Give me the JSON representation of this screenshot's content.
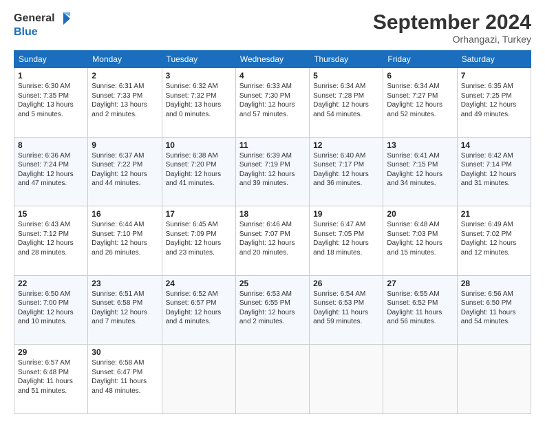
{
  "logo": {
    "line1": "General",
    "line2": "Blue"
  },
  "title": "September 2024",
  "subtitle": "Orhangazi, Turkey",
  "days_of_week": [
    "Sunday",
    "Monday",
    "Tuesday",
    "Wednesday",
    "Thursday",
    "Friday",
    "Saturday"
  ],
  "weeks": [
    [
      {
        "day": "1",
        "info": "Sunrise: 6:30 AM\nSunset: 7:35 PM\nDaylight: 13 hours\nand 5 minutes."
      },
      {
        "day": "2",
        "info": "Sunrise: 6:31 AM\nSunset: 7:33 PM\nDaylight: 13 hours\nand 2 minutes."
      },
      {
        "day": "3",
        "info": "Sunrise: 6:32 AM\nSunset: 7:32 PM\nDaylight: 13 hours\nand 0 minutes."
      },
      {
        "day": "4",
        "info": "Sunrise: 6:33 AM\nSunset: 7:30 PM\nDaylight: 12 hours\nand 57 minutes."
      },
      {
        "day": "5",
        "info": "Sunrise: 6:34 AM\nSunset: 7:28 PM\nDaylight: 12 hours\nand 54 minutes."
      },
      {
        "day": "6",
        "info": "Sunrise: 6:34 AM\nSunset: 7:27 PM\nDaylight: 12 hours\nand 52 minutes."
      },
      {
        "day": "7",
        "info": "Sunrise: 6:35 AM\nSunset: 7:25 PM\nDaylight: 12 hours\nand 49 minutes."
      }
    ],
    [
      {
        "day": "8",
        "info": "Sunrise: 6:36 AM\nSunset: 7:24 PM\nDaylight: 12 hours\nand 47 minutes."
      },
      {
        "day": "9",
        "info": "Sunrise: 6:37 AM\nSunset: 7:22 PM\nDaylight: 12 hours\nand 44 minutes."
      },
      {
        "day": "10",
        "info": "Sunrise: 6:38 AM\nSunset: 7:20 PM\nDaylight: 12 hours\nand 41 minutes."
      },
      {
        "day": "11",
        "info": "Sunrise: 6:39 AM\nSunset: 7:19 PM\nDaylight: 12 hours\nand 39 minutes."
      },
      {
        "day": "12",
        "info": "Sunrise: 6:40 AM\nSunset: 7:17 PM\nDaylight: 12 hours\nand 36 minutes."
      },
      {
        "day": "13",
        "info": "Sunrise: 6:41 AM\nSunset: 7:15 PM\nDaylight: 12 hours\nand 34 minutes."
      },
      {
        "day": "14",
        "info": "Sunrise: 6:42 AM\nSunset: 7:14 PM\nDaylight: 12 hours\nand 31 minutes."
      }
    ],
    [
      {
        "day": "15",
        "info": "Sunrise: 6:43 AM\nSunset: 7:12 PM\nDaylight: 12 hours\nand 28 minutes."
      },
      {
        "day": "16",
        "info": "Sunrise: 6:44 AM\nSunset: 7:10 PM\nDaylight: 12 hours\nand 26 minutes."
      },
      {
        "day": "17",
        "info": "Sunrise: 6:45 AM\nSunset: 7:09 PM\nDaylight: 12 hours\nand 23 minutes."
      },
      {
        "day": "18",
        "info": "Sunrise: 6:46 AM\nSunset: 7:07 PM\nDaylight: 12 hours\nand 20 minutes."
      },
      {
        "day": "19",
        "info": "Sunrise: 6:47 AM\nSunset: 7:05 PM\nDaylight: 12 hours\nand 18 minutes."
      },
      {
        "day": "20",
        "info": "Sunrise: 6:48 AM\nSunset: 7:03 PM\nDaylight: 12 hours\nand 15 minutes."
      },
      {
        "day": "21",
        "info": "Sunrise: 6:49 AM\nSunset: 7:02 PM\nDaylight: 12 hours\nand 12 minutes."
      }
    ],
    [
      {
        "day": "22",
        "info": "Sunrise: 6:50 AM\nSunset: 7:00 PM\nDaylight: 12 hours\nand 10 minutes."
      },
      {
        "day": "23",
        "info": "Sunrise: 6:51 AM\nSunset: 6:58 PM\nDaylight: 12 hours\nand 7 minutes."
      },
      {
        "day": "24",
        "info": "Sunrise: 6:52 AM\nSunset: 6:57 PM\nDaylight: 12 hours\nand 4 minutes."
      },
      {
        "day": "25",
        "info": "Sunrise: 6:53 AM\nSunset: 6:55 PM\nDaylight: 12 hours\nand 2 minutes."
      },
      {
        "day": "26",
        "info": "Sunrise: 6:54 AM\nSunset: 6:53 PM\nDaylight: 11 hours\nand 59 minutes."
      },
      {
        "day": "27",
        "info": "Sunrise: 6:55 AM\nSunset: 6:52 PM\nDaylight: 11 hours\nand 56 minutes."
      },
      {
        "day": "28",
        "info": "Sunrise: 6:56 AM\nSunset: 6:50 PM\nDaylight: 11 hours\nand 54 minutes."
      }
    ],
    [
      {
        "day": "29",
        "info": "Sunrise: 6:57 AM\nSunset: 6:48 PM\nDaylight: 11 hours\nand 51 minutes."
      },
      {
        "day": "30",
        "info": "Sunrise: 6:58 AM\nSunset: 6:47 PM\nDaylight: 11 hours\nand 48 minutes."
      },
      null,
      null,
      null,
      null,
      null
    ]
  ]
}
